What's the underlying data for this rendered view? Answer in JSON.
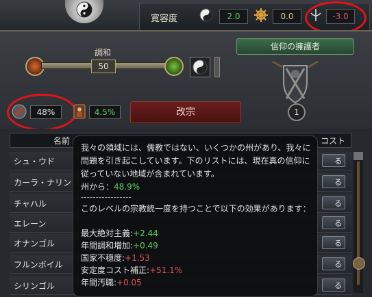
{
  "tolerance": {
    "label": "寛容度",
    "true_faith": "2.0",
    "heretics": "0.0",
    "heathens": "-3.0"
  },
  "harmony": {
    "label": "調和",
    "value": "50"
  },
  "defender": {
    "label": "信仰の擁護者",
    "count": "1"
  },
  "unity": {
    "value": "48%",
    "piety": "4.5%"
  },
  "convert_button": "改宗",
  "table": {
    "name_header": "名前",
    "cost_header": "コスト",
    "rows": [
      {
        "name": "シュ・ウド",
        "button": "る"
      },
      {
        "name": "カーラ・ナリン",
        "button": "る"
      },
      {
        "name": "チャハル",
        "button": "る"
      },
      {
        "name": "エレーン",
        "button": "る"
      },
      {
        "name": "オナンゴル",
        "button": "る"
      },
      {
        "name": "フルンボイル",
        "button": "る"
      },
      {
        "name": "シリンゴル",
        "button": "る"
      }
    ]
  },
  "tooltip": {
    "line1": "我々の領域には、儒教ではない、いくつかの州があり、我々に",
    "line2": "問題を引き起こしています。下のリストには、現在真の信仰に",
    "line3": "従っていない地域が含まれています。",
    "provinces_label": "州から：",
    "provinces_value": "48.9%",
    "divider": "-----------------",
    "effect_intro": "このレベルの宗教統一度を持つことで以下の効果があります：",
    "effects": [
      {
        "label": "最大絶対主義:",
        "value": "+2.44"
      },
      {
        "label": "年間調和増加:",
        "value": "+0.49"
      },
      {
        "label": "国家不穏度:",
        "value": "+1.53"
      },
      {
        "label": "安定度コスト補正:",
        "value": "+51.1%"
      },
      {
        "label": "年間汚職:",
        "value": "+0.05"
      }
    ]
  },
  "colors": {
    "positive": "#5fcf5f",
    "negative": "#e0565a",
    "highlight_ring": "#e0141a"
  }
}
